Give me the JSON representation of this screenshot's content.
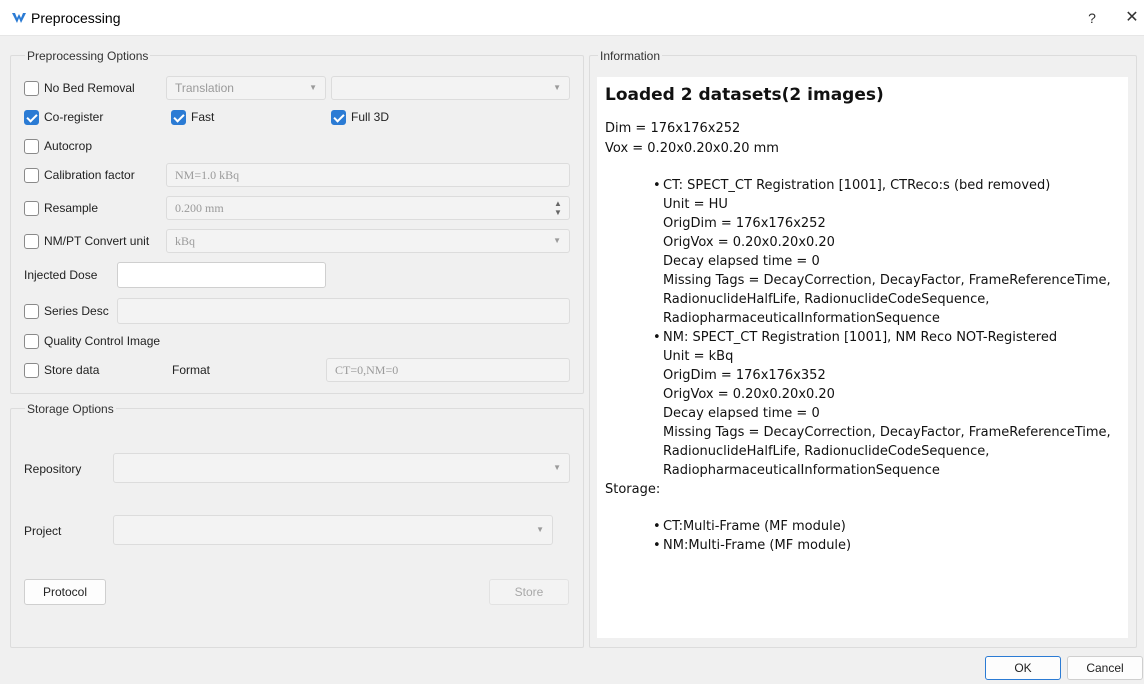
{
  "window": {
    "title": "Preprocessing",
    "help": "?",
    "close": "✕"
  },
  "preprocessing": {
    "group_title": "Preprocessing Options",
    "no_bed_removal": {
      "label": "No Bed Removal",
      "checked": false
    },
    "translation_combo": "Translation",
    "co_register": {
      "label": "Co-register",
      "checked": true
    },
    "fast": {
      "label": "Fast",
      "checked": true
    },
    "full3d": {
      "label": "Full 3D",
      "checked": true
    },
    "autocrop": {
      "label": "Autocrop",
      "checked": false
    },
    "calibration": {
      "label": "Calibration factor",
      "value": "NM=1.0 kBq",
      "checked": false
    },
    "resample": {
      "label": "Resample",
      "value": "0.200 mm",
      "checked": false
    },
    "convert_unit": {
      "label": "NM/PT Convert unit",
      "value": "kBq",
      "checked": false
    },
    "injected_dose": {
      "label": "Injected Dose",
      "value": ""
    },
    "series_desc": {
      "label": "Series Desc",
      "value": "",
      "checked": false
    },
    "quality_control": {
      "label": "Quality Control Image",
      "checked": false
    },
    "store_data": {
      "label": "Store data",
      "checked": false
    },
    "format_label": "Format",
    "format_value": "CT=0,NM=0"
  },
  "storage": {
    "group_title": "Storage Options",
    "repository_label": "Repository",
    "repository_value": "",
    "project_label": "Project",
    "project_value": "",
    "protocol_button": "Protocol",
    "store_button": "Store"
  },
  "information": {
    "group_title": "Information",
    "heading": "Loaded 2 datasets(2 images)",
    "dim": "Dim = 176x176x252",
    "vox": "Vox = 0.20x0.20x0.20 mm",
    "ct": {
      "title": "CT: SPECT_CT Registration [1001], CTReco:s (bed removed)",
      "unit": "Unit = HU",
      "origdim": "OrigDim = 176x176x252",
      "origvox": "OrigVox = 0.20x0.20x0.20",
      "decay": "Decay elapsed time = 0",
      "missing1": "Missing Tags = DecayCorrection, DecayFactor, FrameReferenceTime,",
      "missing2": "RadionuclideHalfLife, RadionuclideCodeSequence,",
      "missing3": "RadiopharmaceuticalInformationSequence"
    },
    "nm": {
      "title": "NM: SPECT_CT Registration [1001], NM Reco NOT-Registered",
      "unit": "Unit = kBq",
      "origdim": "OrigDim = 176x176x352",
      "origvox": "OrigVox = 0.20x0.20x0.20",
      "decay": "Decay elapsed time = 0",
      "missing1": "Missing Tags = DecayCorrection, DecayFactor, FrameReferenceTime,",
      "missing2": "RadionuclideHalfLife, RadionuclideCodeSequence,",
      "missing3": "RadiopharmaceuticalInformationSequence"
    },
    "storage_label": "Storage:",
    "storage_ct": "CT:Multi-Frame (MF module)",
    "storage_nm": "NM:Multi-Frame (MF module)",
    "bullet": "•"
  },
  "footer": {
    "ok": "OK",
    "cancel": "Cancel"
  },
  "colors": {
    "accent": "#2b7bd4",
    "background": "#f0f0f0"
  }
}
